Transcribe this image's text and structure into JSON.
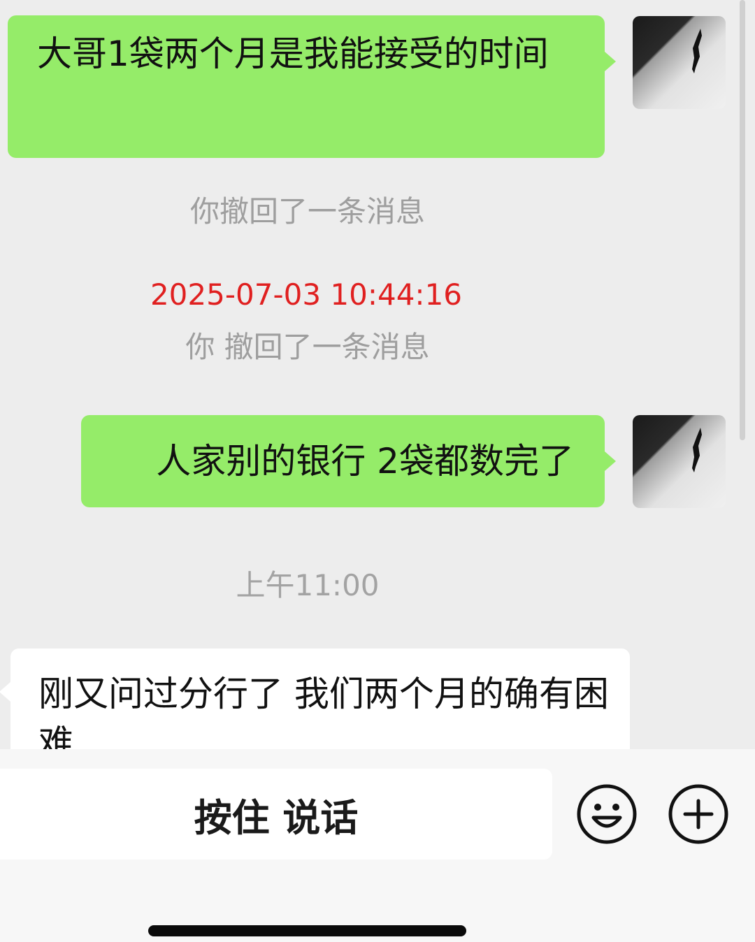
{
  "messages": [
    {
      "direction": "outgoing",
      "text": "大哥1袋两个月是我能接受的时间"
    },
    {
      "direction": "outgoing",
      "text": "人家别的银行 2袋都数完了"
    },
    {
      "direction": "incoming",
      "text": "刚又问过分行了 我们两个月的确有困难"
    }
  ],
  "system": {
    "recall_1": "你撤回了一条消息",
    "recall_2": "你 撤回了一条消息",
    "red_timestamp": "2025-07-03 10:44:16",
    "time_label": "上午11:00"
  },
  "input_bar": {
    "hold_to_talk_label": "按住 说话",
    "emoji_icon": "emoji-icon",
    "plus_icon": "plus-icon"
  },
  "colors": {
    "outgoing_bubble": "#95ec69",
    "incoming_bubble": "#ffffff",
    "background": "#ededed",
    "red_timestamp": "#e02020"
  }
}
